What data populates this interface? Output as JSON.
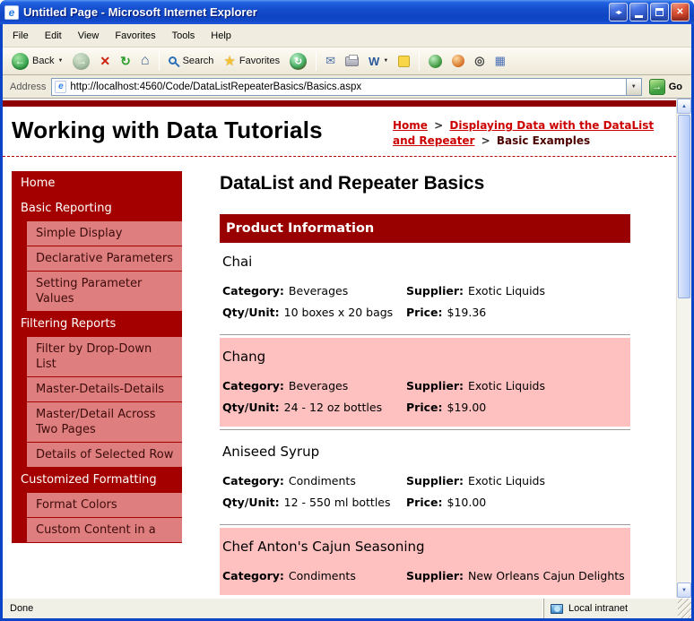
{
  "window": {
    "title": "Untitled Page - Microsoft Internet Explorer"
  },
  "icons": {
    "back_arrow": "←",
    "forward_arrow": "→",
    "stop_x": "✕",
    "refresh": "↻",
    "home": "⌂",
    "star": "★",
    "history": "↻",
    "mail": "✉",
    "edit_letter": "W",
    "caret": "▼",
    "address_dropdown": "▼",
    "go_arrow": "→",
    "scroll_up": "▲",
    "scroll_down": "▼",
    "binoculars": "◎",
    "grid": "▦",
    "resize": "◂▸",
    "close": "✕",
    "logo_letter": "e"
  },
  "menu": {
    "items": [
      "File",
      "Edit",
      "View",
      "Favorites",
      "Tools",
      "Help"
    ]
  },
  "toolbar": {
    "back_label": "Back",
    "search_label": "Search",
    "favorites_label": "Favorites"
  },
  "address": {
    "label": "Address",
    "url": "http://localhost:4560/Code/DataListRepeaterBasics/Basics.aspx",
    "go_label": "Go"
  },
  "page": {
    "header": {
      "title": "Working with Data Tutorials",
      "breadcrumb": {
        "home": "Home",
        "separator": ">",
        "section": "Displaying Data with the DataList and Repeater",
        "current": "Basic Examples"
      }
    },
    "sidebar": {
      "items": [
        {
          "label": "Home",
          "level": 1
        },
        {
          "label": "Basic Reporting",
          "level": 1
        },
        {
          "label": "Simple Display",
          "level": 2
        },
        {
          "label": "Declarative Parameters",
          "level": 2
        },
        {
          "label": "Setting Parameter Values",
          "level": 2
        },
        {
          "label": "Filtering Reports",
          "level": 1
        },
        {
          "label": "Filter by Drop-Down List",
          "level": 2
        },
        {
          "label": "Master-Details-Details",
          "level": 2
        },
        {
          "label": "Master/Detail Across Two Pages",
          "level": 2
        },
        {
          "label": "Details of Selected Row",
          "level": 2
        },
        {
          "label": "Customized Formatting",
          "level": 1
        },
        {
          "label": "Format Colors",
          "level": 2
        },
        {
          "label": "Custom Content in a",
          "level": 2
        }
      ]
    },
    "main": {
      "title": "DataList and Repeater Basics",
      "banner": "Product Information",
      "labels": {
        "category": "Category:",
        "supplier": "Supplier:",
        "qty": "Qty/Unit:",
        "price": "Price:"
      },
      "products": [
        {
          "name": "Chai",
          "category": "Beverages",
          "supplier": "Exotic Liquids",
          "qty": "10 boxes x 20 bags",
          "price": "$19.36",
          "alt": false
        },
        {
          "name": "Chang",
          "category": "Beverages",
          "supplier": "Exotic Liquids",
          "qty": "24 - 12 oz bottles",
          "price": "$19.00",
          "alt": true
        },
        {
          "name": "Aniseed Syrup",
          "category": "Condiments",
          "supplier": "Exotic Liquids",
          "qty": "12 - 550 ml bottles",
          "price": "$10.00",
          "alt": false
        },
        {
          "name": "Chef Anton's Cajun Seasoning",
          "category": "Condiments",
          "supplier": "New Orleans Cajun Delights",
          "alt": true
        }
      ]
    }
  },
  "statusbar": {
    "left": "Done",
    "right": "Local intranet"
  }
}
